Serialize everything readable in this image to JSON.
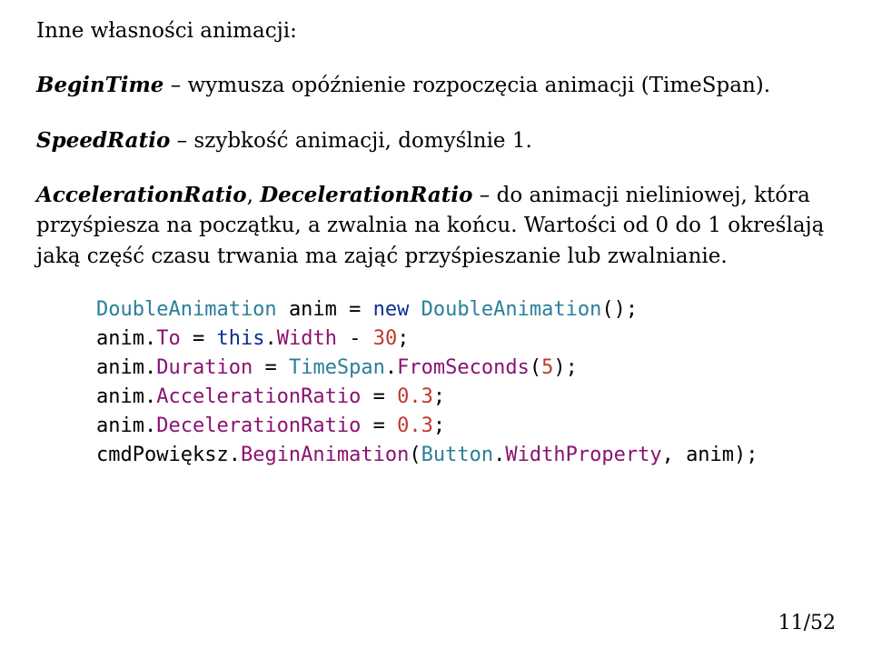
{
  "heading": "Inne własności animacji:",
  "para1": {
    "prop": "BeginTime",
    "rest": " – wymusza opóźnienie rozpoczęcia animacji (TimeSpan)."
  },
  "para2": {
    "prop": "SpeedRatio",
    "rest": " – szybkość animacji, domyślnie 1."
  },
  "para3": {
    "prop1": "AccelerationRatio",
    "sep": ", ",
    "prop2": "DecelerationRatio",
    "rest": " – do animacji nieliniowej, która przyśpiesza na początku, a zwalnia na końcu. Wartości od 0 do 1 określają jaką część czasu trwania ma zająć przyśpieszanie lub zwalnianie."
  },
  "code": {
    "t_DoubleAnimation": "DoubleAnimation",
    "t_TimeSpan": "TimeSpan",
    "t_Button": "Button",
    "var_anim": "anim",
    "var_cmd": "cmdPowiększ",
    "kw_new": "new",
    "kw_this": "this",
    "p_To": "To",
    "p_Width": "Width",
    "p_Duration": "Duration",
    "p_FromSeconds": "FromSeconds",
    "p_AccelerationRatio": "AccelerationRatio",
    "p_DecelerationRatio": "DecelerationRatio",
    "p_BeginAnimation": "BeginAnimation",
    "p_WidthProperty": "WidthProperty",
    "n_30": "30",
    "n_5": "5",
    "n_03a": "0.3",
    "n_03b": "0.3",
    "eq": " = ",
    "dot": ".",
    "semi": ";",
    "open": "(",
    "close": ")",
    "comma_sp": ", ",
    "minus": " - ",
    "space": " "
  },
  "pagenum": "11/52"
}
